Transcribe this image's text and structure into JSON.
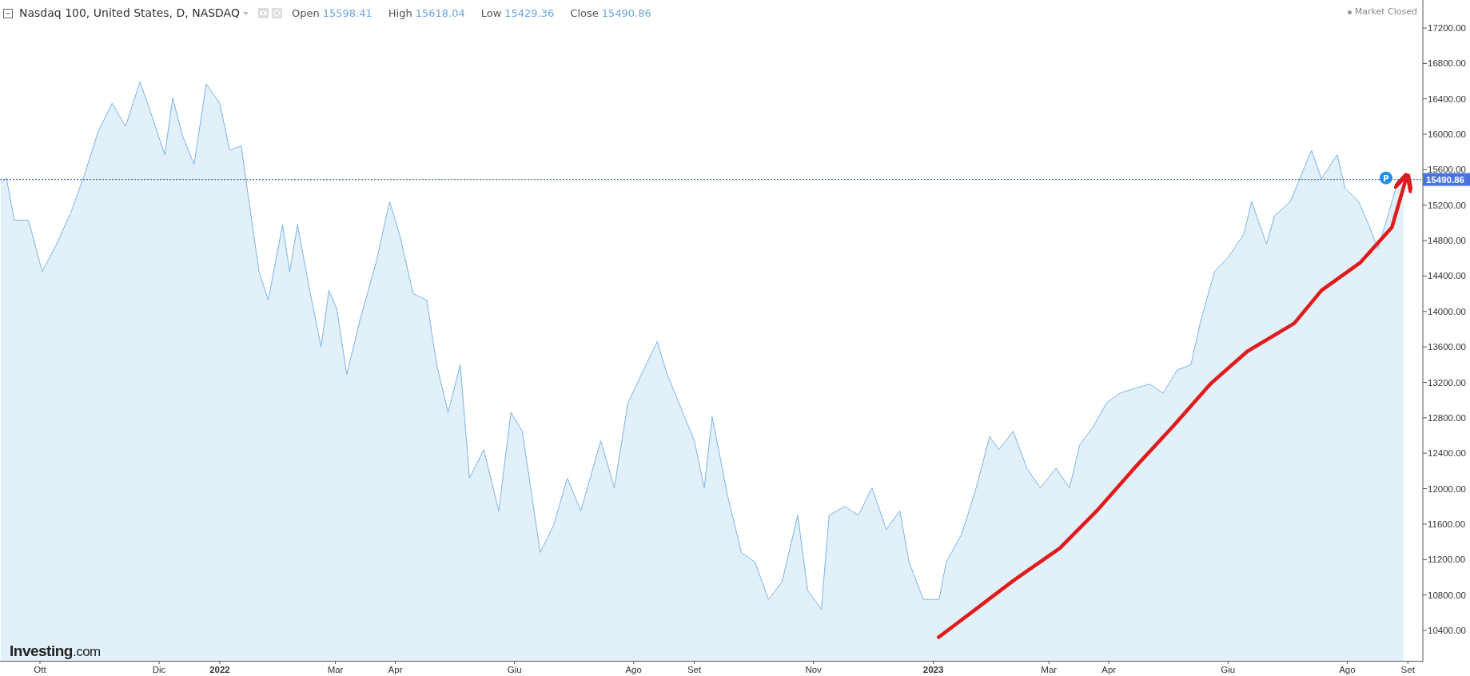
{
  "header": {
    "title": "Nasdaq 100, United States, D, NASDAQ",
    "ohlc": [
      {
        "label": "Open",
        "value": "15598.41"
      },
      {
        "label": "High",
        "value": "15618.04"
      },
      {
        "label": "Low",
        "value": "15429.36"
      },
      {
        "label": "Close",
        "value": "15490.86"
      }
    ]
  },
  "market_status": "Market Closed",
  "chart": {
    "last_price_label": "15490.86",
    "marker_label": "P",
    "chart_data": {
      "type": "area",
      "xlim": [
        2021.692,
        2023.686
      ],
      "ylim": [
        10057,
        17516
      ],
      "x": [
        2021.693,
        2021.701,
        2021.712,
        2021.732,
        2021.751,
        2021.77,
        2021.792,
        2021.811,
        2021.83,
        2021.849,
        2021.868,
        2021.888,
        2021.901,
        2021.923,
        2021.934,
        2021.948,
        2021.964,
        2021.981,
        2022.0,
        2022.014,
        2022.03,
        2022.041,
        2022.055,
        2022.068,
        2022.088,
        2022.098,
        2022.109,
        2022.126,
        2022.142,
        2022.153,
        2022.164,
        2022.178,
        2022.197,
        2022.219,
        2022.238,
        2022.252,
        2022.271,
        2022.29,
        2022.304,
        2022.32,
        2022.337,
        2022.35,
        2022.37,
        2022.391,
        2022.408,
        2022.424,
        2022.449,
        2022.468,
        2022.487,
        2022.506,
        2022.534,
        2022.553,
        2022.572,
        2022.591,
        2022.613,
        2022.627,
        2022.646,
        2022.665,
        2022.679,
        2022.69,
        2022.712,
        2022.731,
        2022.75,
        2022.769,
        2022.788,
        2022.81,
        2022.824,
        2022.843,
        2022.854,
        2022.876,
        2022.895,
        2022.914,
        2022.934,
        2022.953,
        2022.966,
        2022.986,
        2023.008,
        2023.018,
        2023.04,
        2023.06,
        2023.079,
        2023.092,
        2023.112,
        2023.131,
        2023.15,
        2023.172,
        2023.191,
        2023.205,
        2023.224,
        2023.243,
        2023.262,
        2023.281,
        2023.303,
        2023.322,
        2023.342,
        2023.361,
        2023.374,
        2023.394,
        2023.413,
        2023.435,
        2023.446,
        2023.467,
        2023.478,
        2023.5,
        2023.511,
        2023.53,
        2023.544,
        2023.566,
        2023.577,
        2023.596,
        2023.61,
        2023.623,
        2023.637,
        2023.651,
        2023.659
      ],
      "series": [
        {
          "color": "#7db4e6",
          "values": [
            15450,
            15510,
            15030,
            15030,
            14450,
            14740,
            15130,
            15560,
            16040,
            16350,
            16090,
            16590,
            16300,
            15770,
            16410,
            15980,
            15660,
            16570,
            16350,
            15820,
            15870,
            15240,
            14450,
            14130,
            14980,
            14450,
            14980,
            14240,
            13600,
            14240,
            14030,
            13290,
            13920,
            14550,
            15240,
            14870,
            14200,
            14130,
            13400,
            12860,
            13400,
            12120,
            12440,
            11750,
            12860,
            12650,
            11280,
            11590,
            12120,
            11750,
            12540,
            12010,
            12970,
            13290,
            13660,
            13290,
            12920,
            12540,
            12010,
            12810,
            11910,
            11280,
            11170,
            10750,
            10950,
            11700,
            10850,
            10640,
            11700,
            11800,
            11700,
            12010,
            11540,
            11750,
            11170,
            10750,
            10750,
            11170,
            11490,
            12010,
            12590,
            12440,
            12650,
            12230,
            12010,
            12230,
            12010,
            12490,
            12700,
            12970,
            13080,
            13130,
            13180,
            13080,
            13340,
            13400,
            13870,
            14450,
            14610,
            14870,
            15240,
            14760,
            15080,
            15240,
            15450,
            15820,
            15500,
            15770,
            15390,
            15240,
            14980,
            14710,
            15080,
            15480,
            15490
          ]
        }
      ],
      "xticks": [
        {
          "value": 2021.748,
          "label": "Ott"
        },
        {
          "value": 2021.915,
          "label": "Dic"
        },
        {
          "value": 2022,
          "label": "2022"
        },
        {
          "value": 2022.162,
          "label": "Mar"
        },
        {
          "value": 2022.246,
          "label": "Apr"
        },
        {
          "value": 2022.413,
          "label": "Giu"
        },
        {
          "value": 2022.58,
          "label": "Ago"
        },
        {
          "value": 2022.665,
          "label": "Set"
        },
        {
          "value": 2022.832,
          "label": "Nov"
        },
        {
          "value": 2023,
          "label": "2023"
        },
        {
          "value": 2023.162,
          "label": "Mar"
        },
        {
          "value": 2023.246,
          "label": "Apr"
        },
        {
          "value": 2023.413,
          "label": "Giu"
        },
        {
          "value": 2023.58,
          "label": "Ago"
        },
        {
          "value": 2023.665,
          "label": "Set"
        }
      ],
      "yticks": [
        {
          "value": 17200,
          "label": "17200.00"
        },
        {
          "value": 16800,
          "label": "16800.00"
        },
        {
          "value": 16400,
          "label": "16400.00"
        },
        {
          "value": 16000,
          "label": "16000.00"
        },
        {
          "value": 15600,
          "label": "15600.00"
        },
        {
          "value": 15200,
          "label": "15200.00"
        },
        {
          "value": 14800,
          "label": "14800.00"
        },
        {
          "value": 14400,
          "label": "14400.00"
        },
        {
          "value": 14000,
          "label": "14000.00"
        },
        {
          "value": 13600,
          "label": "13600.00"
        },
        {
          "value": 13200,
          "label": "13200.00"
        },
        {
          "value": 12800,
          "label": "12800.00"
        },
        {
          "value": 12400,
          "label": "12400.00"
        },
        {
          "value": 12000,
          "label": "12000.00"
        },
        {
          "value": 11600,
          "label": "11600.00"
        },
        {
          "value": 11200,
          "label": "11200.00"
        },
        {
          "value": 10800,
          "label": "10800.00"
        },
        {
          "value": 10400,
          "label": "10400.00"
        }
      ]
    }
  },
  "logo": "**Investing**.com"
}
